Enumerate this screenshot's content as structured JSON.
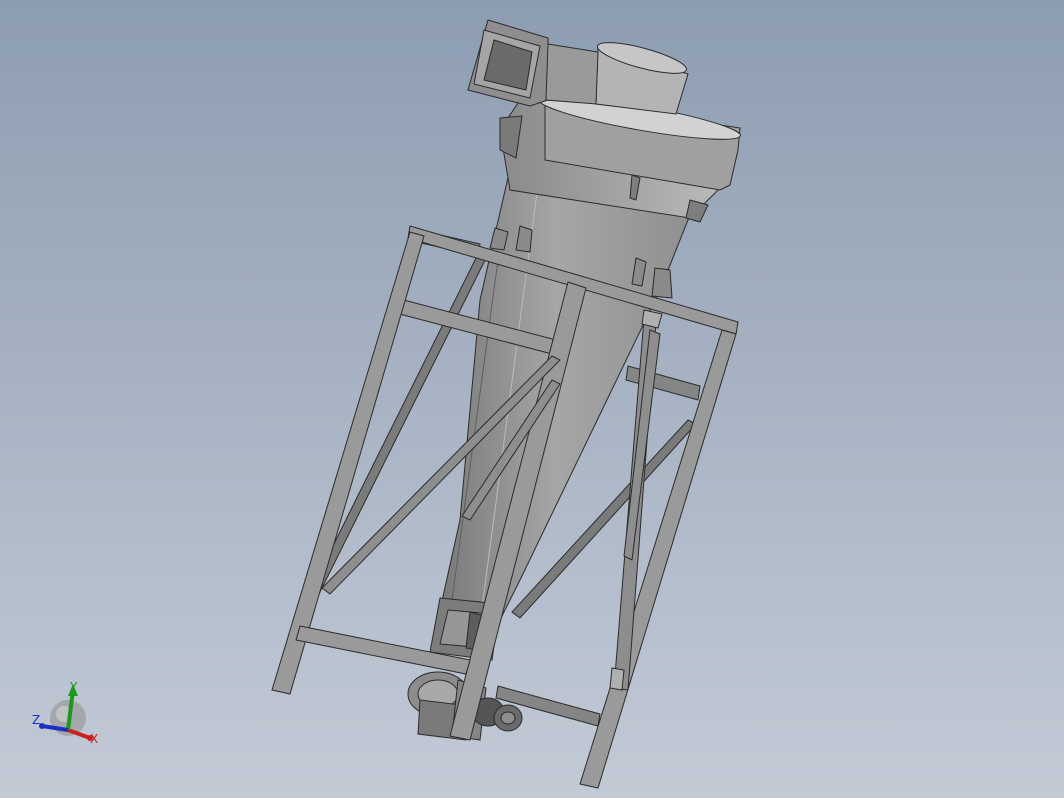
{
  "viewport": {
    "background_top": "#8d9db1",
    "background_bottom": "#c3cad6",
    "model": "cyclone-separator-assembly"
  },
  "colors": {
    "body_fill": "#9c9c9c",
    "body_light": "#c8c8c8",
    "body_dark": "#6e6e6e",
    "frame_fill": "#8a8a8a",
    "edge": "#2b2b2b"
  },
  "triad": {
    "x_label": "X",
    "y_label": "Y",
    "z_label": "Z",
    "x_color": "#cc2020",
    "y_color": "#1a9a1a",
    "z_color": "#1a2fbf"
  }
}
